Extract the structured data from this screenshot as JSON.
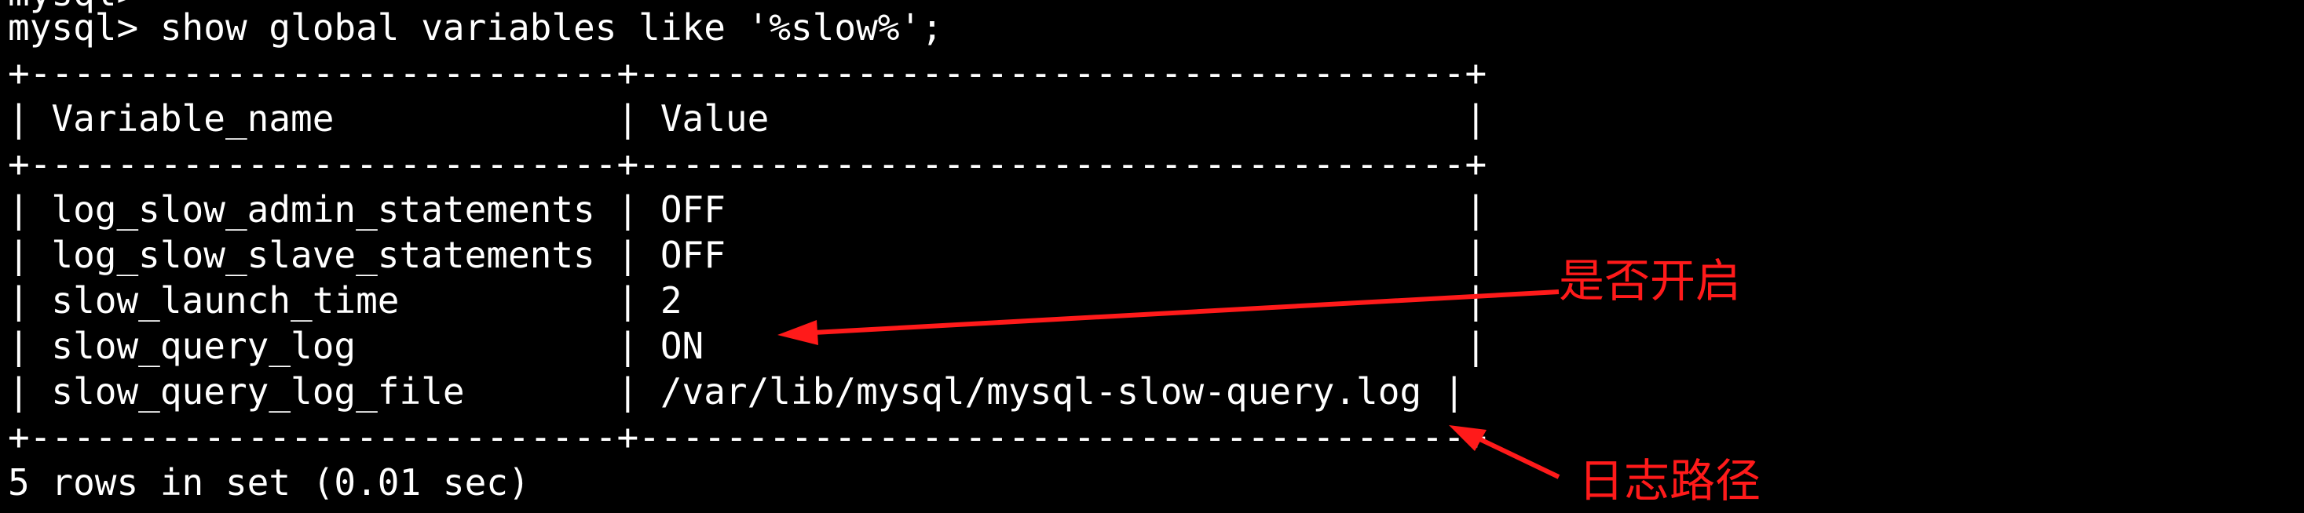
{
  "terminal": {
    "partial_top_line": "mysql>",
    "command_line": "mysql> show global variables like '%slow%';",
    "border_line": "+---------------------------+--------------------------------------+",
    "header_line": "| Variable_name             | Value                                |",
    "rows": [
      "| log_slow_admin_statements | OFF                                  |",
      "| log_slow_slave_statements | OFF                                  |",
      "| slow_launch_time          | 2                                    |",
      "| slow_query_log            | ON                                   |",
      "| slow_query_log_file       | /var/lib/mysql/mysql-slow-query.log |"
    ],
    "footer_line": "5 rows in set (0.01 sec)"
  },
  "annotations": {
    "enabled_label": "是否开启",
    "path_label": "日志路径",
    "color": "#ff1a1a"
  }
}
